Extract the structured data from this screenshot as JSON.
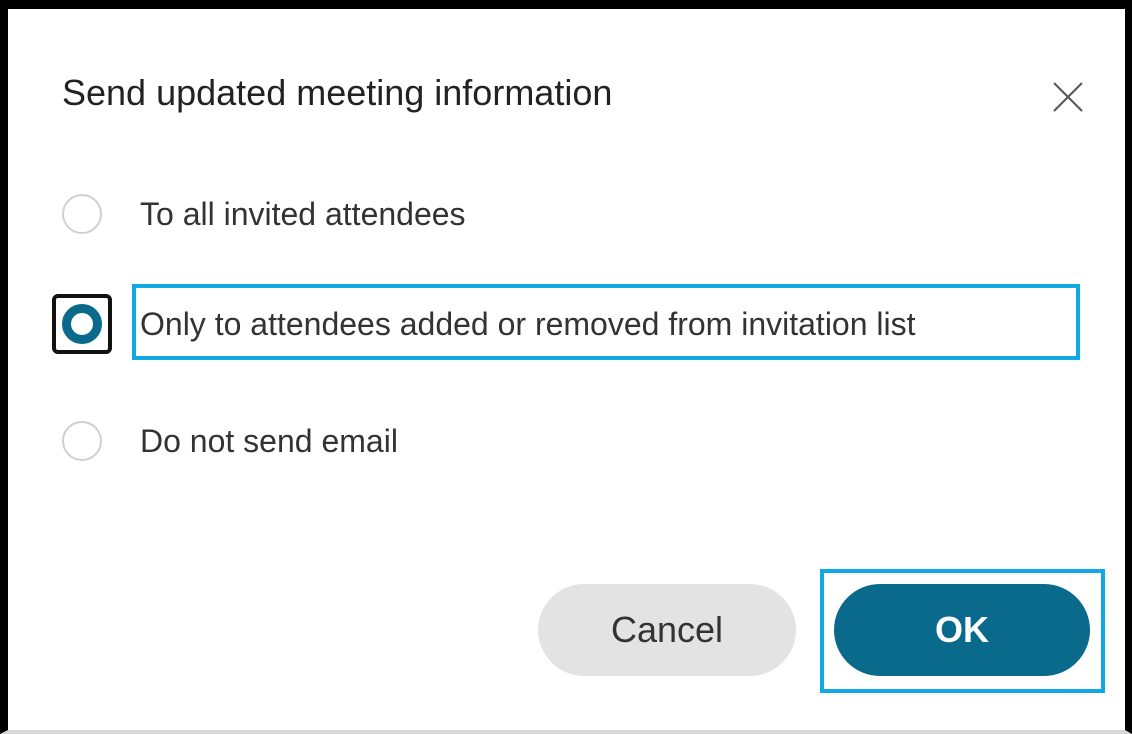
{
  "dialog": {
    "title": "Send updated meeting information",
    "close_icon": "close-icon"
  },
  "options": [
    {
      "label": "To all invited attendees",
      "checked": false
    },
    {
      "label": "Only to attendees added or removed from invitation list",
      "checked": true
    },
    {
      "label": "Do not send email",
      "checked": false
    }
  ],
  "buttons": {
    "cancel_label": "Cancel",
    "ok_label": "OK"
  },
  "colors": {
    "accent": "#0a6a8c",
    "highlight": "#11a9e3",
    "cancel_bg": "#e3e3e3"
  }
}
